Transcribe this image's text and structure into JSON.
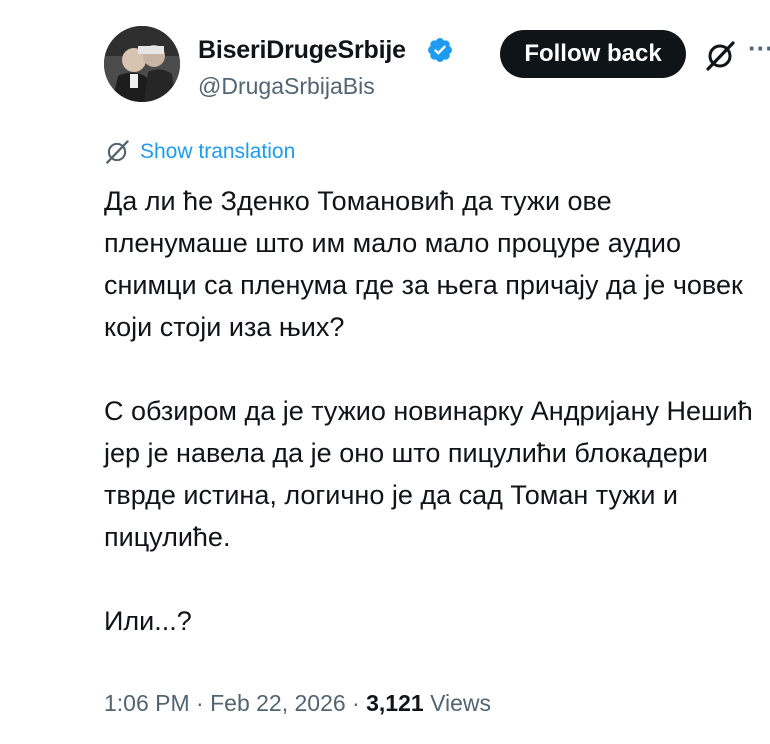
{
  "author": {
    "display_name": "BiseriDrugeSrbije",
    "handle": "@DrugaSrbijaBis",
    "verified": true
  },
  "actions": {
    "follow_label": "Follow back",
    "grok_icon": "grok-icon",
    "more_icon": "more-icon"
  },
  "translation": {
    "label": "Show translation"
  },
  "tweet": {
    "paragraphs": [
      "Да ли ће Зденко Томановић да тужи ове пленумаше што им мало мало процуре аудио снимци са пленума где за њега причају да је човек који стоји иза њих?",
      "С обзиром да је тужио новинарку Андријану Нешић јер је навела да је оно што пицулићи блокадери тврде истина, логично је да сад Томан тужи и пицулиће.",
      "Или...?"
    ]
  },
  "meta": {
    "time": "1:06 PM",
    "separator": " · ",
    "date": "Feb 22, 2026",
    "views_count": "3,121",
    "views_label": " Views"
  },
  "colors": {
    "text": "#0f1419",
    "secondary": "#536471",
    "accent": "#1d9bf0",
    "button_bg": "#0f1419"
  }
}
